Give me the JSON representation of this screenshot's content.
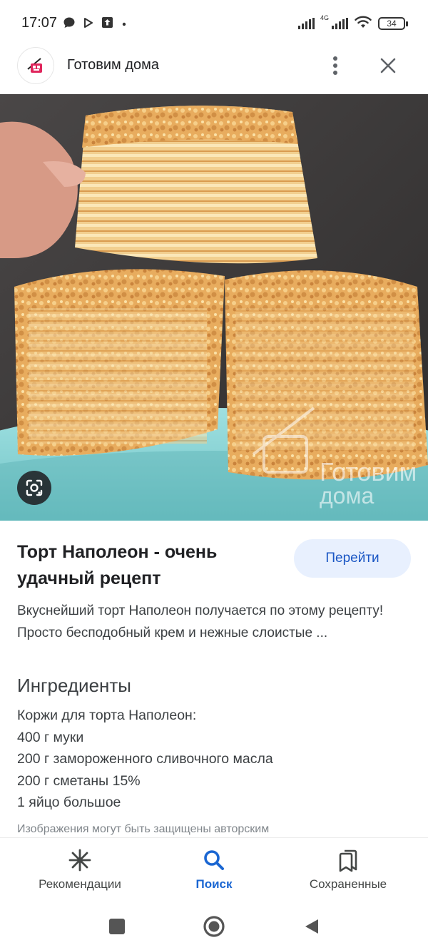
{
  "status_bar": {
    "time": "17:07",
    "network_label": "4G",
    "battery": "34",
    "left_icons": [
      "chat-bubble-icon",
      "play-store-icon",
      "upload-icon",
      "dot-icon"
    ],
    "right_icons": [
      "signal-icon",
      "signal-4g-icon",
      "wifi-icon",
      "battery-icon"
    ]
  },
  "header": {
    "site_name": "Готовим дома",
    "menu_icon": "more-vert-icon",
    "close_icon": "close-icon"
  },
  "hero": {
    "watermark_line1": "Готовим",
    "watermark_line2": "дома",
    "lens_icon": "lens-camera-icon"
  },
  "result": {
    "title": "Торт Наполеон - очень удачный рецепт",
    "go_button": "Перейти",
    "description": "Вкуснейший торт Наполеон получается по этому рецепту! Просто бесподобный крем и нежные слоистые ...",
    "ingredients_heading": "Ингредиенты",
    "ingredients": [
      "Коржи для торта Наполеон:",
      "400 г муки",
      "200 г замороженного сливочного масла",
      "200 г сметаны 15%",
      "1 яйцо большое"
    ],
    "copyright_note": "Изображения могут быть защищены авторским"
  },
  "bottom_nav": {
    "items": [
      {
        "label": "Рекомендации",
        "icon": "asterisk-icon",
        "active": false
      },
      {
        "label": "Поиск",
        "icon": "search-icon",
        "active": true
      },
      {
        "label": "Сохраненные",
        "icon": "bookmarks-icon",
        "active": false
      }
    ]
  },
  "system_nav": {
    "icons": [
      "recents-square-icon",
      "home-circle-icon",
      "back-triangle-icon"
    ]
  },
  "colors": {
    "accent": "#1a66d2",
    "button_bg": "#e8f0fe",
    "plate": "#86d4d6",
    "cake": "#e9b46a"
  }
}
